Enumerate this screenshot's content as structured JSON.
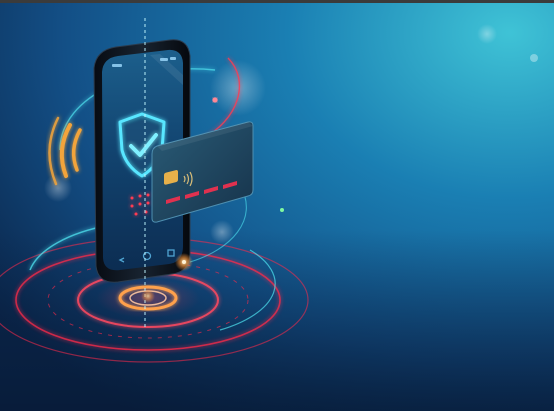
{
  "scene": {
    "colors": {
      "bg_top_right": "#3fc3d6",
      "bg_mid": "#1565a3",
      "bg_deep": "#0a2448",
      "ring_red": "#ff2a4a",
      "ring_cyan": "#4fe3f0",
      "glow_orange": "#ff9a3c",
      "nfc_wave": "#f2a43b",
      "shield": "#59e6ff",
      "card_face": "#1e3d57",
      "card_chip": "#e6b04a",
      "card_bars": "#e0314f"
    },
    "icons": [
      "smartphone",
      "shield-check-icon",
      "credit-card",
      "card-chip-icon",
      "contactless-icon",
      "nfc-wave-icon",
      "phone-home-icon",
      "phone-back-icon"
    ]
  }
}
